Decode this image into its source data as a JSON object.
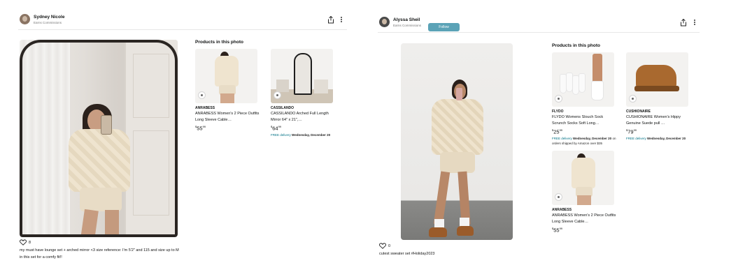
{
  "colors": {
    "follow": "#5ba3b7",
    "link": "#007185",
    "boot": "#a9692f"
  },
  "left_card": {
    "user": {
      "name": "Sydney Nicole",
      "subtitle": "Earns Commissions"
    },
    "likes": "8",
    "caption": "my must have lounge set + arched mirror <3 size reference: I'm 5'2\" and 115 and size up to M in this set for a comfy fit!!",
    "products_title": "Products in this photo",
    "products": [
      {
        "brand": "ANRABESS",
        "title": "ANRABESS Women's 2 Piece Outfits Long Sleeve Cable…",
        "price_whole": "55",
        "price_frac": "99",
        "currency": "$"
      },
      {
        "brand": "CASSILANDO",
        "title": "CASSILANDO Arched Full Length Mirror 64\" x 21\",…",
        "price_whole": "64",
        "price_frac": "99",
        "currency": "$",
        "delivery_free": "FREE delivery",
        "delivery_day": "Wednesday,",
        "delivery_date": "December 20"
      }
    ]
  },
  "right_card": {
    "user": {
      "name": "Alyssa Sheil",
      "subtitle": "Earns Commissions",
      "follow_label": "Follow"
    },
    "likes": "0",
    "caption": "cutest sweater set #Holiday2023",
    "products_title": "Products in this photo",
    "products": [
      {
        "brand": "FLYDO",
        "title": "FLYDO Womens Slouch Sock Scrunch Socks Soft Long…",
        "price_whole": "25",
        "price_frac": "99",
        "currency": "$",
        "delivery_free": "FREE delivery",
        "delivery_day": "Wednesday,",
        "delivery_date": "December 20",
        "delivery_note": "on orders shipped by Amazon over $35"
      },
      {
        "brand": "CUSHIONAIRE",
        "title": "CUSHIONAIRE Women's Hippy Genuine Suede pull …",
        "price_whole": "79",
        "price_frac": "99",
        "currency": "$",
        "delivery_free": "FREE delivery",
        "delivery_day": "Wednesday,",
        "delivery_date": "December 20"
      },
      {
        "brand": "ANRABESS",
        "title": "ANRABESS Women's 2 Piece Outfits Long Sleeve Cable…",
        "price_whole": "55",
        "price_frac": "99",
        "currency": "$"
      }
    ]
  },
  "icons": {
    "share": "share-icon",
    "more": "more-vertical-icon",
    "like": "heart-icon",
    "badge": "shop-badge-icon"
  }
}
